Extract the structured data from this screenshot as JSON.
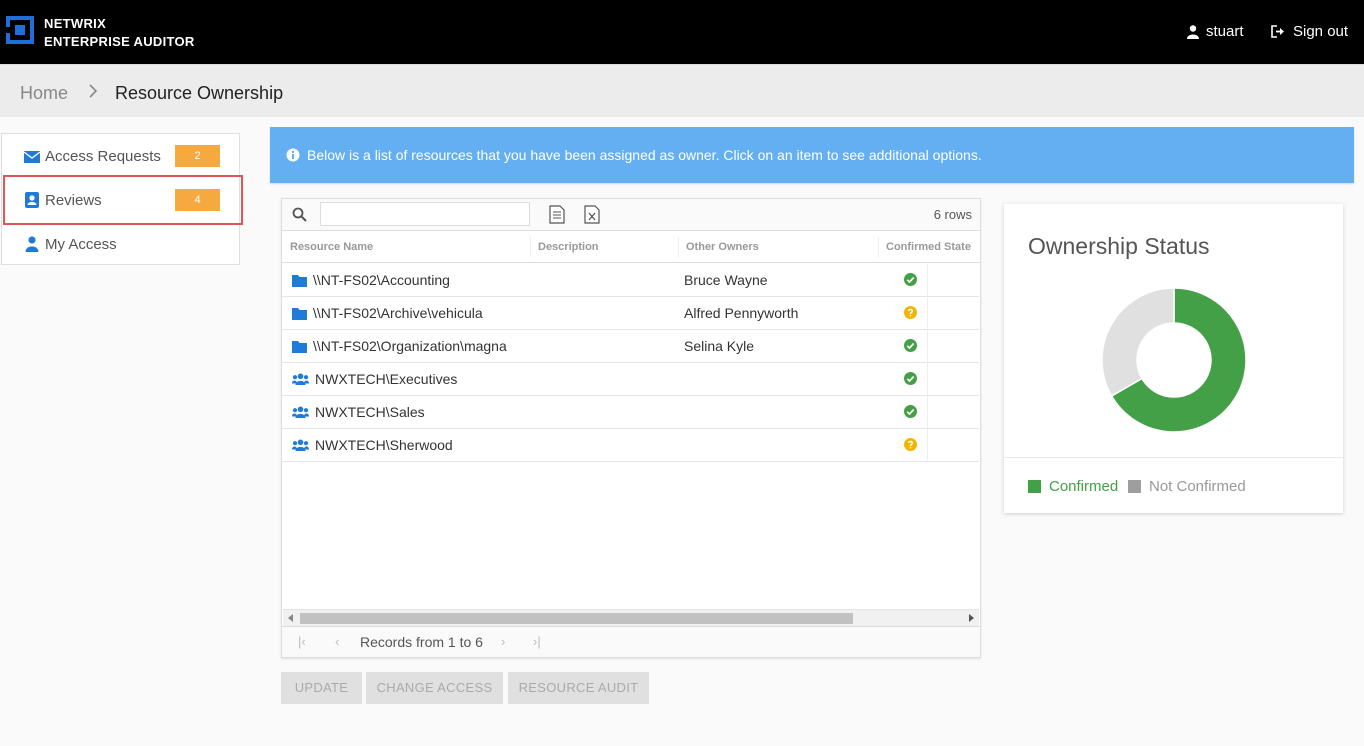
{
  "header": {
    "brand_line1": "NETWRIX",
    "brand_line2": "ENTERPRISE AUDITOR",
    "user_name": "stuart",
    "sign_out": "Sign out"
  },
  "breadcrumb": {
    "home": "Home",
    "current": "Resource Ownership"
  },
  "sidebar": {
    "items": [
      {
        "label": "Access Requests",
        "badge": "2",
        "icon": "envelope-icon"
      },
      {
        "label": "Reviews",
        "badge": "4",
        "icon": "contact-card-icon"
      },
      {
        "label": "My Access",
        "badge": "",
        "icon": "user-icon"
      }
    ]
  },
  "info": {
    "text": "Below is a list of resources that you have been assigned as owner. Click on an item to see additional options."
  },
  "grid": {
    "search_placeholder": "",
    "row_count": "6 rows",
    "columns": [
      "Resource Name",
      "Description",
      "Other Owners",
      "Confirmed State"
    ],
    "rows": [
      {
        "name": "\\\\NT-FS02\\Accounting",
        "type": "folder",
        "description": "",
        "owners": "Bruce Wayne",
        "state": "confirmed"
      },
      {
        "name": "\\\\NT-FS02\\Archive\\vehicula",
        "type": "folder",
        "description": "",
        "owners": "Alfred Pennyworth",
        "state": "unknown"
      },
      {
        "name": "\\\\NT-FS02\\Organization\\magna",
        "type": "folder",
        "description": "",
        "owners": "Selina Kyle",
        "state": "confirmed"
      },
      {
        "name": "NWXTECH\\Executives",
        "type": "group",
        "description": "",
        "owners": "",
        "state": "confirmed"
      },
      {
        "name": "NWXTECH\\Sales",
        "type": "group",
        "description": "",
        "owners": "",
        "state": "confirmed"
      },
      {
        "name": "NWXTECH\\Sherwood",
        "type": "group",
        "description": "",
        "owners": "",
        "state": "unknown"
      }
    ],
    "pager_text": "Records from 1 to 6"
  },
  "actions": {
    "update": "UPDATE",
    "change_access": "CHANGE ACCESS",
    "resource_audit": "RESOURCE AUDIT"
  },
  "ownership": {
    "title": "Ownership Status",
    "confirmed_label": "Confirmed",
    "not_confirmed_label": "Not Confirmed",
    "confirmed_count": 4,
    "not_confirmed_count": 2,
    "colors": {
      "confirmed": "#43a047",
      "not_confirmed": "#e0e0e0",
      "legend_not_confirmed": "#9e9e9e"
    }
  },
  "colors": {
    "accent": "#63aff2",
    "badge": "#f5a93f",
    "confirmed": "#43a047",
    "unknown": "#f4b400",
    "icon_blue": "#1e7bd8"
  }
}
